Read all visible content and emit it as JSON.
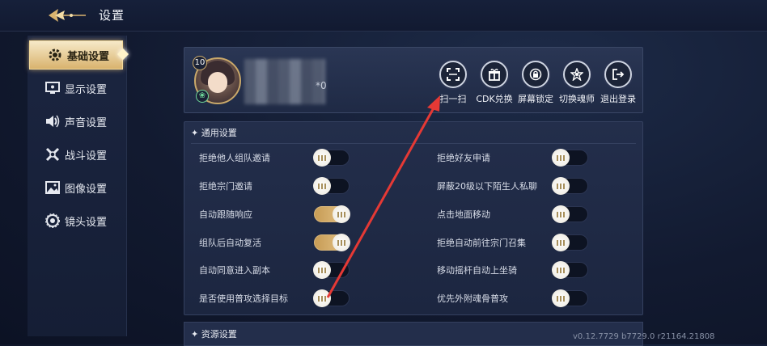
{
  "header": {
    "title": "设置",
    "back_icon": "back-arrow-icon"
  },
  "sidebar": {
    "items": [
      {
        "label": "基础设置",
        "icon": "gear-icon",
        "active": true
      },
      {
        "label": "显示设置",
        "icon": "monitor-icon",
        "active": false
      },
      {
        "label": "声音设置",
        "icon": "speaker-icon",
        "active": false
      },
      {
        "label": "战斗设置",
        "icon": "swords-icon",
        "active": false
      },
      {
        "label": "图像设置",
        "icon": "image-icon",
        "active": false
      },
      {
        "label": "镜头设置",
        "icon": "camera-icon",
        "active": false
      }
    ]
  },
  "profile": {
    "level": "10",
    "name_suffix": "*0",
    "actions": [
      {
        "label": "扫一扫",
        "icon": "scan-icon"
      },
      {
        "label": "CDK兑换",
        "icon": "gift-icon"
      },
      {
        "label": "屏幕锁定",
        "icon": "lock-icon"
      },
      {
        "label": "切换魂师",
        "icon": "switch-character-icon"
      },
      {
        "label": "退出登录",
        "icon": "logout-icon"
      }
    ]
  },
  "general": {
    "title": "通用设置",
    "left": [
      {
        "label": "拒绝他人组队邀请",
        "on": false
      },
      {
        "label": "拒绝宗门邀请",
        "on": false
      },
      {
        "label": "自动跟随响应",
        "on": true
      },
      {
        "label": "组队后自动复活",
        "on": true
      },
      {
        "label": "自动同意进入副本",
        "on": false
      },
      {
        "label": "是否使用普攻选择目标",
        "on": false
      }
    ],
    "right": [
      {
        "label": "拒绝好友申请",
        "on": false
      },
      {
        "label": "屏蔽20级以下陌生人私聊",
        "on": false
      },
      {
        "label": "点击地面移动",
        "on": false
      },
      {
        "label": "拒绝自动前往宗门召集",
        "on": false
      },
      {
        "label": "移动摇杆自动上坐骑",
        "on": false
      },
      {
        "label": "优先外附魂骨普攻",
        "on": false
      }
    ]
  },
  "resources": {
    "title": "资源设置"
  },
  "version": "v0.12.7729 b7729.0 r21164.21808",
  "colors": {
    "accent_gold": "#d9b36e",
    "annotation_arrow": "#e53935"
  }
}
